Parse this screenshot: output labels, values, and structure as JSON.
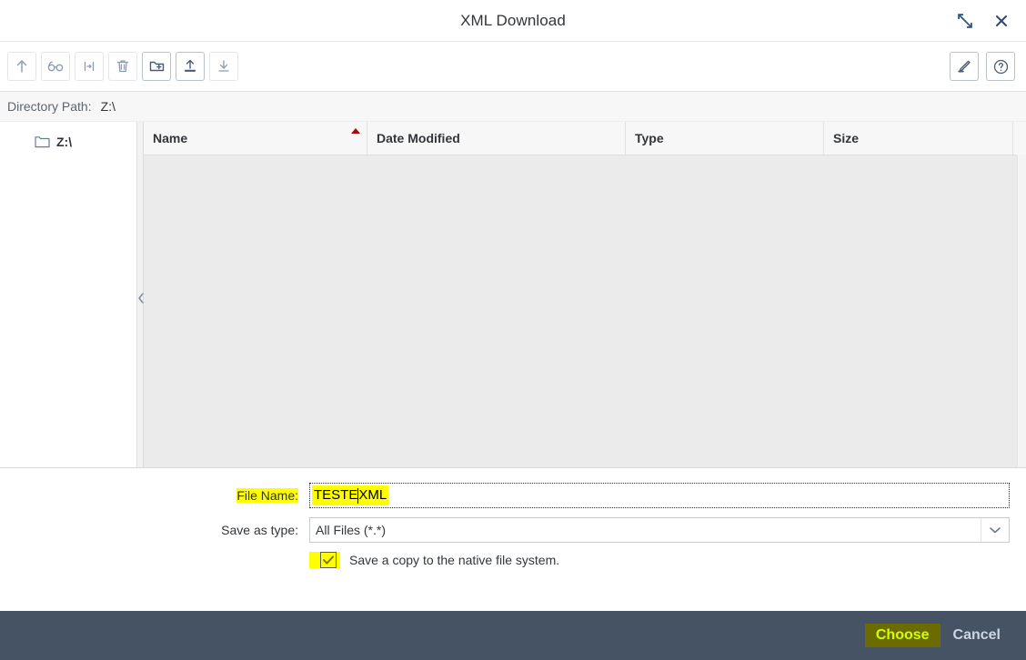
{
  "dialog": {
    "title": "XML Download",
    "maximize_icon": "expand-icon",
    "close_icon": "close-icon"
  },
  "toolbar": {
    "items": [
      {
        "name": "navigate-up-button",
        "icon": "arrow-up-icon",
        "enabled": false
      },
      {
        "name": "view-button",
        "icon": "glasses-icon",
        "enabled": false
      },
      {
        "name": "rename-button",
        "icon": "rename-icon",
        "enabled": false
      },
      {
        "name": "delete-button",
        "icon": "trash-icon",
        "enabled": false
      },
      {
        "name": "new-folder-button",
        "icon": "folder-add-icon",
        "enabled": true
      },
      {
        "name": "upload-button",
        "icon": "upload-icon",
        "enabled": true
      },
      {
        "name": "download-button",
        "icon": "download-icon",
        "enabled": false
      }
    ],
    "right_items": [
      {
        "name": "edit-button",
        "icon": "pen-icon",
        "enabled": true
      },
      {
        "name": "help-button",
        "icon": "question-circle-icon",
        "enabled": true
      }
    ]
  },
  "directory": {
    "label": "Directory Path:",
    "value": "Z:\\"
  },
  "tree": {
    "nodes": [
      {
        "label": "Z:\\",
        "icon": "folder-icon"
      }
    ]
  },
  "table": {
    "columns": [
      {
        "key": "name",
        "label": "Name",
        "sort": "asc"
      },
      {
        "key": "date_modified",
        "label": "Date Modified",
        "sort": ""
      },
      {
        "key": "type",
        "label": "Type",
        "sort": ""
      },
      {
        "key": "size",
        "label": "Size",
        "sort": ""
      }
    ],
    "rows": []
  },
  "form": {
    "file_name": {
      "label": "File Name:",
      "value_before_caret": "TESTE",
      "value_after_caret": "XML",
      "value": "TESTE.XML"
    },
    "save_as_type": {
      "label": "Save as type:",
      "value": "All Files (*.*)",
      "options": [
        "All Files (*.*)"
      ],
      "arrow_icon": "chevron-down-icon"
    },
    "native_copy": {
      "label": "Save a copy to the native file system.",
      "checked": true,
      "check_icon": "check-icon"
    }
  },
  "footer": {
    "choose_label": "Choose",
    "cancel_label": "Cancel"
  },
  "colors": {
    "highlight": "#ffff00",
    "footer_bg": "#465365",
    "accent_blue": "#31567e",
    "sort_arrow": "#aa0808",
    "choose_text": "#d4ff00",
    "choose_bg": "#6b6b00"
  }
}
